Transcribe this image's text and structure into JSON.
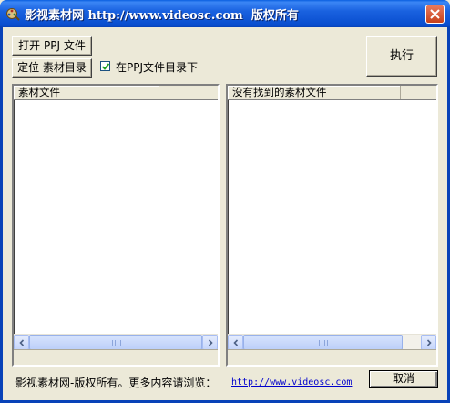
{
  "window": {
    "title": "影视素材网 http://www.videosc.com  版权所有"
  },
  "toolbar": {
    "open_ppj_label": "打开 PPJ 文件",
    "locate_label": "定位 素材目录",
    "in_ppj_dir_checked": true,
    "in_ppj_dir_label": "在PPJ文件目录下",
    "run_label": "执行"
  },
  "lists": {
    "left": {
      "header": "素材文件",
      "items": []
    },
    "right": {
      "header": "没有找到的素材文件",
      "items": []
    }
  },
  "footer": {
    "copyright_text": "影视素材网-版权所有。更多内容请浏览：",
    "link_text": "http://www.videosc.com",
    "cancel_label": "取消"
  },
  "colors": {
    "titlebar": "#0A4FD0",
    "window_bg": "#ECE9D8",
    "link": "#0000CC"
  },
  "icons": [
    "app-icon",
    "close-icon",
    "checkmark-icon",
    "scroll-left-icon",
    "scroll-right-icon"
  ]
}
